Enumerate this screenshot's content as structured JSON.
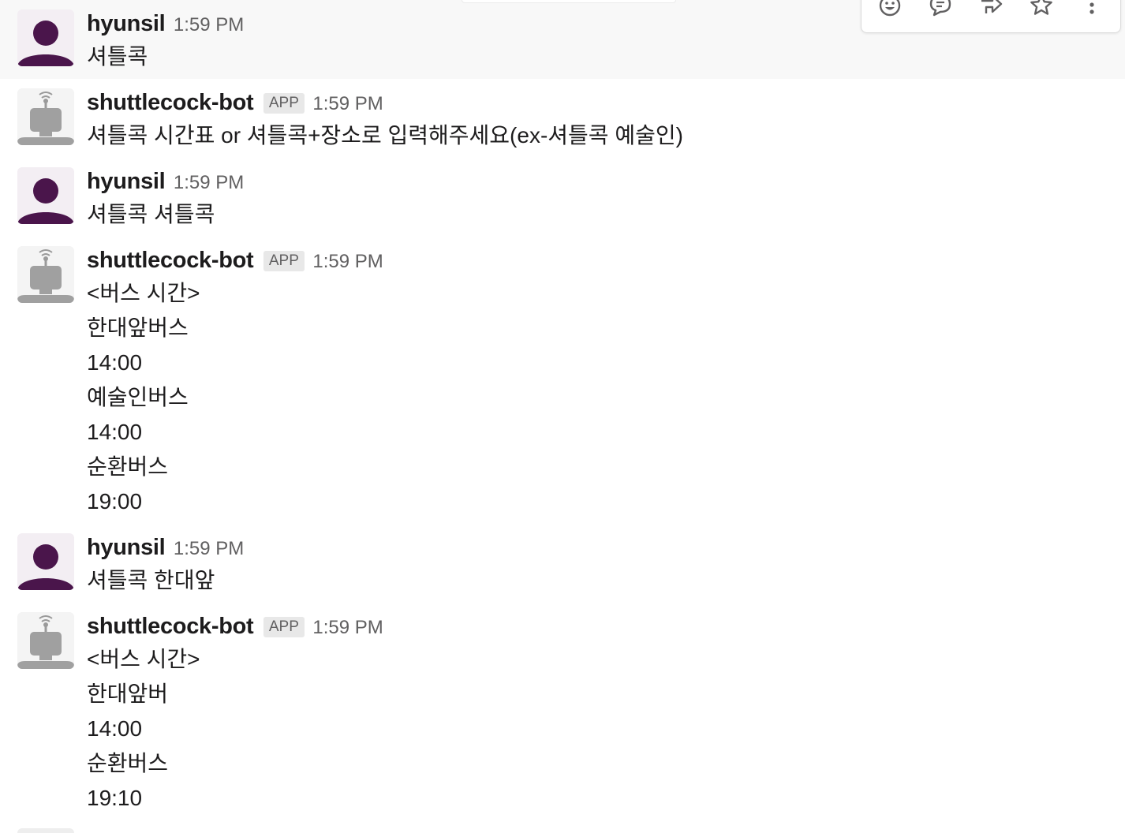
{
  "messages": [
    {
      "sender": "hyunsil",
      "time": "1:59 PM",
      "lines": [
        "셔틀콕"
      ]
    },
    {
      "sender": "shuttlecock-bot",
      "badge": "APP",
      "time": "1:59 PM",
      "lines": [
        "셔틀콕 시간표 or 셔틀콕+장소로 입력해주세요(ex-셔틀콕 예술인)"
      ]
    },
    {
      "sender": "hyunsil",
      "time": "1:59 PM",
      "lines": [
        "셔틀콕 셔틀콕"
      ]
    },
    {
      "sender": "shuttlecock-bot",
      "badge": "APP",
      "time": "1:59 PM",
      "lines": [
        "<버스 시간>",
        "한대앞버스",
        "14:00",
        "예술인버스",
        "14:00",
        "순환버스",
        "19:00"
      ]
    },
    {
      "sender": "hyunsil",
      "time": "1:59 PM",
      "lines": [
        "셔틀콕 한대앞"
      ]
    },
    {
      "sender": "shuttlecock-bot",
      "badge": "APP",
      "time": "1:59 PM",
      "lines": [
        "<버스 시간>",
        "한대앞버",
        "14:00",
        "순환버스",
        "19:10"
      ]
    }
  ],
  "message_actions": {
    "items": [
      "add-reaction-icon",
      "reply-in-thread-icon",
      "share-message-icon",
      "save-star-icon",
      "more-actions-icon"
    ]
  },
  "colors": {
    "user_avatar": "#4a154b",
    "bot_avatar": "#a0a0a0",
    "hover_row": "#f8f8f8",
    "text": "#1d1c1d",
    "muted": "#616061",
    "badge_bg": "#e8e8e8"
  }
}
